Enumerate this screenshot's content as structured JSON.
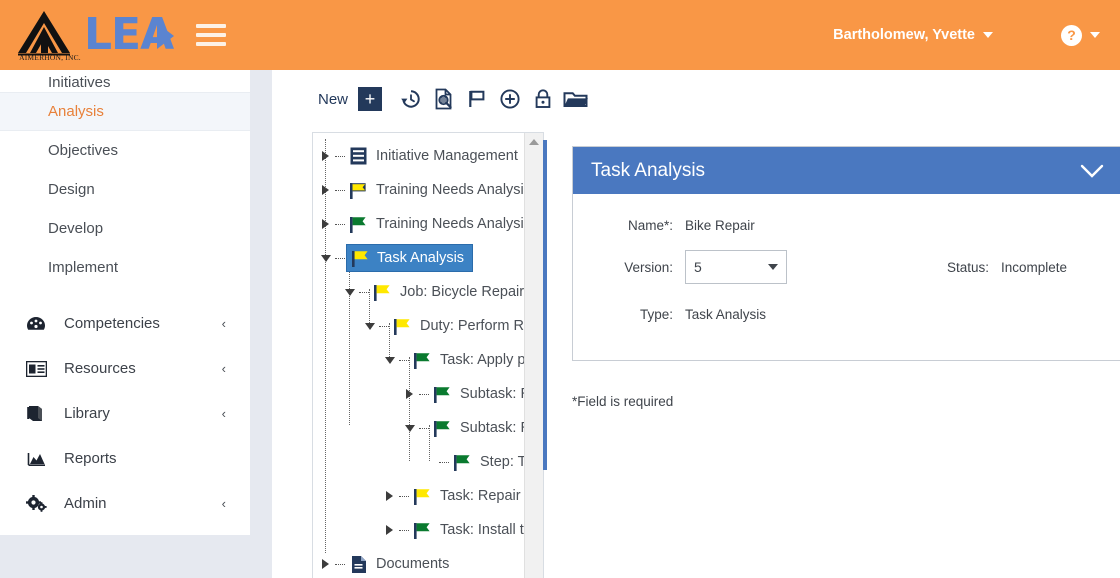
{
  "header": {
    "logo_company": "AIMERHON, INC.",
    "logo_word": "LEA",
    "menu_icon": "hamburger-icon",
    "user_name": "Bartholomew, Yvette",
    "help_glyph": "?",
    "bg_color": "#f99746"
  },
  "sidebar": {
    "items": [
      {
        "label": "Initiatives",
        "icon": "",
        "chevron": "",
        "active": false
      },
      {
        "label": "Analysis",
        "icon": "",
        "chevron": "",
        "active": true
      },
      {
        "label": "Objectives",
        "icon": "",
        "chevron": "",
        "active": false
      },
      {
        "label": "Design",
        "icon": "",
        "chevron": "",
        "active": false
      },
      {
        "label": "Develop",
        "icon": "",
        "chevron": "",
        "active": false
      },
      {
        "label": "Implement",
        "icon": "",
        "chevron": "",
        "active": false
      }
    ],
    "groups": [
      {
        "label": "Competencies",
        "icon": "dashboard-icon",
        "chevron": "‹"
      },
      {
        "label": "Resources",
        "icon": "id-card-icon",
        "chevron": "‹"
      },
      {
        "label": "Library",
        "icon": "book-icon",
        "chevron": "‹"
      },
      {
        "label": "Reports",
        "icon": "area-chart-icon",
        "chevron": ""
      },
      {
        "label": "Admin",
        "icon": "cogs-icon",
        "chevron": "‹"
      }
    ],
    "active_color": "#e8813a"
  },
  "toolbar": {
    "new_label": "New",
    "new_plus": "+",
    "icons": [
      "history-icon",
      "document-search-icon",
      "flag-icon",
      "plus-circle-icon",
      "lock-icon",
      "folder-open-icon"
    ],
    "accent_color": "#23395b"
  },
  "tree": {
    "nodes": [
      {
        "label": "Initiative Management",
        "icon": "list-icon",
        "twisty": "collapsed",
        "depth": 0,
        "selected": false
      },
      {
        "label": "Training Needs Analysis ((",
        "icon": "flag-yellow-icon",
        "twisty": "collapsed",
        "depth": 0,
        "selected": false
      },
      {
        "label": "Training Needs Analysis",
        "icon": "flag-green-icon",
        "twisty": "collapsed",
        "depth": 0,
        "selected": false
      },
      {
        "label": "Task Analysis",
        "icon": "flag-yellow-icon",
        "twisty": "expanded",
        "depth": 0,
        "selected": true
      },
      {
        "label": "Job: Bicycle Repairers",
        "icon": "flag-yellow-icon",
        "twisty": "expanded",
        "depth": 1,
        "selected": false
      },
      {
        "label": "Duty: Perform Routi",
        "icon": "flag-yellow-icon",
        "twisty": "expanded",
        "depth": 2,
        "selected": false
      },
      {
        "label": "Task: Apply princ",
        "icon": "flag-green-icon",
        "twisty": "expanded",
        "depth": 3,
        "selected": false
      },
      {
        "label": "Subtask: Rem",
        "icon": "flag-green-icon",
        "twisty": "collapsed",
        "depth": 4,
        "selected": false
      },
      {
        "label": "Subtask: Rem",
        "icon": "flag-green-icon",
        "twisty": "expanded",
        "depth": 4,
        "selected": false
      },
      {
        "label": "Step: Twis",
        "icon": "flag-green-icon",
        "twisty": "leaf",
        "depth": 5,
        "selected": false
      },
      {
        "label": "Task: Repair hol",
        "icon": "flag-yellow-icon",
        "twisty": "collapsed",
        "depth": 3,
        "selected": false
      },
      {
        "label": "Task: Install tires",
        "icon": "flag-green-icon",
        "twisty": "collapsed",
        "depth": 3,
        "selected": false
      },
      {
        "label": "Documents",
        "icon": "document-icon",
        "twisty": "collapsed",
        "depth": 0,
        "selected": false
      }
    ],
    "selected_bg": "#3c82c4",
    "scrollbar": "vertical-scrollbar"
  },
  "task_panel": {
    "title": "Task Analysis",
    "collapse_icon": "chevron-down-icon",
    "header_color": "#4a78c0",
    "fields": {
      "name_label": "Name*:",
      "name_value": "Bike Repair",
      "version_label": "Version:",
      "version_value": "5",
      "status_label": "Status:",
      "status_value": "Incomplete",
      "type_label": "Type:",
      "type_value": "Task Analysis"
    },
    "required_note": "*Field is required"
  }
}
